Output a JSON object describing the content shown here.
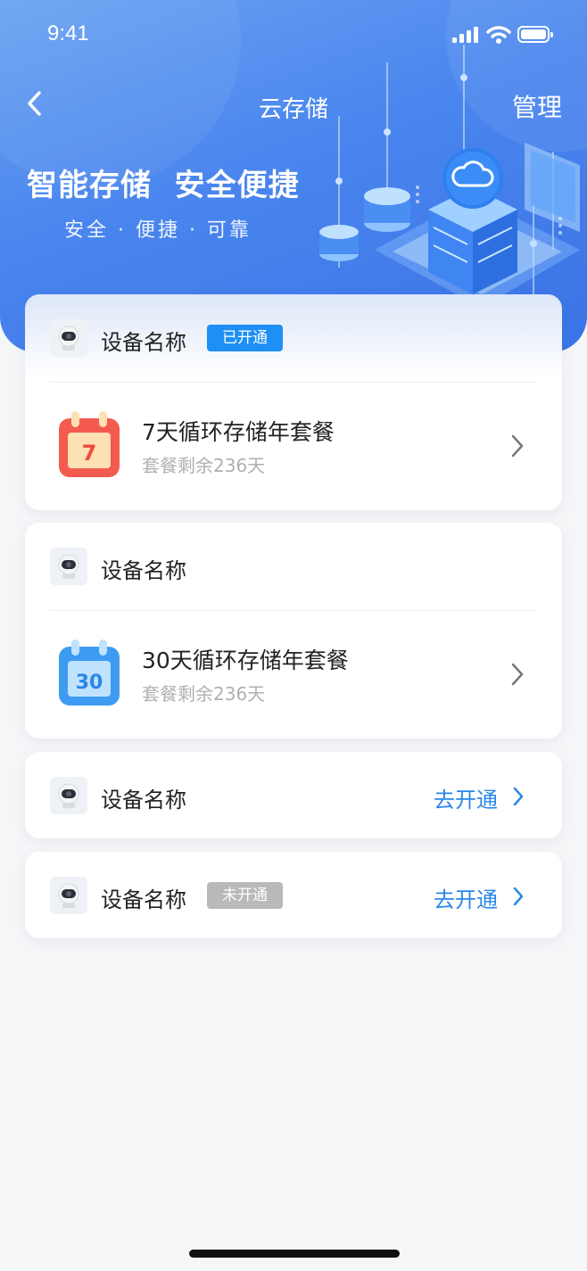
{
  "status_bar": {
    "time": "9:41"
  },
  "nav": {
    "title": "云存储",
    "manage_label": "管理"
  },
  "hero": {
    "title": "智能存储  安全便捷",
    "subtitle": "安全 · 便捷 · 可靠"
  },
  "cards": [
    {
      "device_name": "设备名称",
      "badge": "已开通",
      "plan": {
        "name": "7天循环存储年套餐",
        "remaining": "套餐剩余236天",
        "icon_number": "7",
        "icon": "calendar-red-icon"
      }
    },
    {
      "device_name": "设备名称",
      "plan": {
        "name": "30天循环存储年套餐",
        "remaining": "套餐剩余236天",
        "icon_number": "30",
        "icon": "calendar-blue-icon"
      }
    },
    {
      "device_name": "设备名称",
      "action": "去开通"
    },
    {
      "device_name": "设备名称",
      "badge": "未开通",
      "action": "去开通"
    }
  ],
  "colors": {
    "header_gradient_start": "#6aa2f2",
    "header_gradient_end": "#3a73e6",
    "badge_active": "#1e8ff5",
    "badge_inactive": "#b9b9b9",
    "action_link": "#2a87e8",
    "calendar_red": "#f45b4f",
    "calendar_blue": "#3d9cf2"
  }
}
